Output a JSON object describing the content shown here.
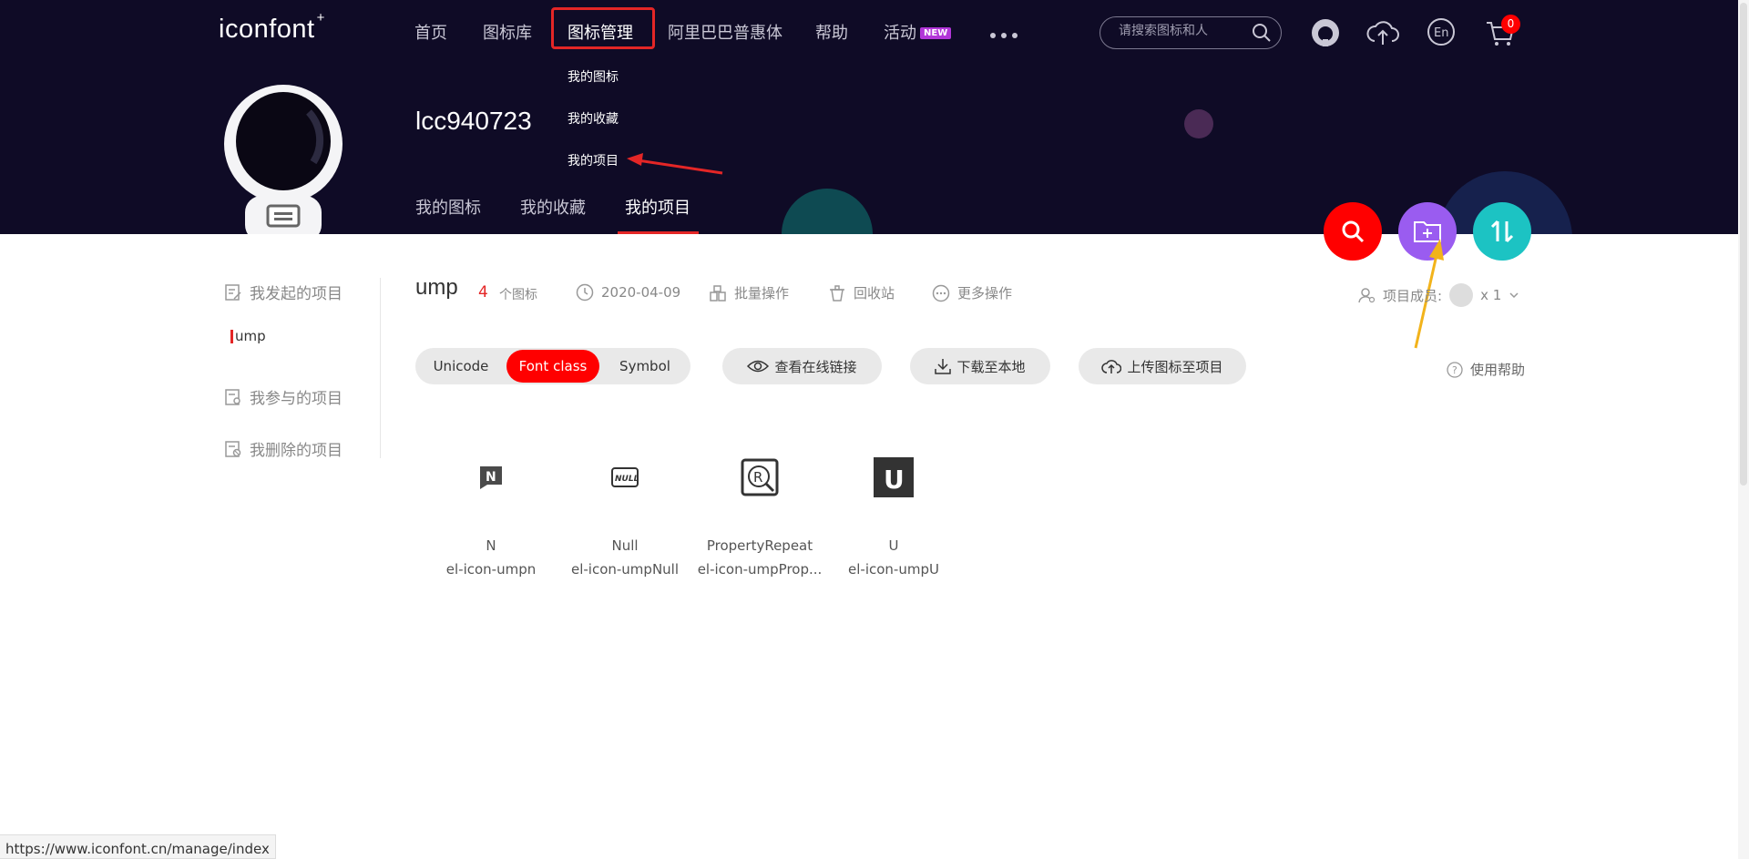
{
  "header": {
    "logo": "iconfont",
    "logo_plus": "+",
    "nav": [
      "首页",
      "图标库",
      "图标管理",
      "阿里巴巴普惠体",
      "帮助",
      "活动"
    ],
    "nav_badge": "NEW",
    "search_placeholder": "请搜索图标和人",
    "cart_count": "0",
    "dropdown": [
      "我的图标",
      "我的收藏",
      "我的项目"
    ]
  },
  "profile": {
    "username": "lcc940723",
    "tabs": [
      "我的图标",
      "我的收藏",
      "我的项目"
    ]
  },
  "sidebar": {
    "items": [
      "我发起的项目",
      "我参与的项目",
      "我删除的项目"
    ],
    "sub_item": "ump"
  },
  "project": {
    "name": "ump",
    "icon_count": "4",
    "icon_unit": "个图标",
    "date": "2020-04-09",
    "actions": [
      "批量操作",
      "回收站",
      "更多操作"
    ],
    "members_label": "项目成员:",
    "members_count": "x 1",
    "modes": [
      "Unicode",
      "Font class",
      "Symbol"
    ],
    "buttons": [
      "查看在线链接",
      "下载至本地",
      "上传图标至项目"
    ],
    "help": "使用帮助"
  },
  "icons": [
    {
      "name": "N",
      "class": "el-icon-umpn"
    },
    {
      "name": "Null",
      "class": "el-icon-umpNull"
    },
    {
      "name": "PropertyRepeat",
      "class": "el-icon-umpProp..."
    },
    {
      "name": "U",
      "class": "el-icon-umpU"
    }
  ],
  "status_url": "https://www.iconfont.cn/manage/index",
  "colors": {
    "header_bg": "#0f0b26",
    "accent": "#e42626",
    "purple": "#9a5cf0",
    "teal": "#1cc3c3"
  }
}
